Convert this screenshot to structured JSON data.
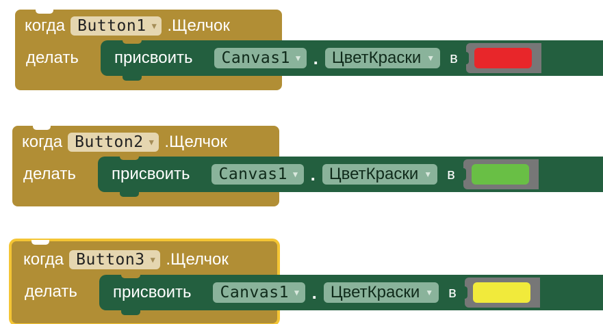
{
  "blocks": [
    {
      "when": "когда",
      "component": "Button1",
      "event": ".Щелчок",
      "do": "делать",
      "set_label": "присвоить",
      "target": "Canvas1",
      "dot": ".",
      "property": "ЦветКраски",
      "to": "в",
      "color": "#e8262a",
      "selected": false
    },
    {
      "when": "когда",
      "component": "Button2",
      "event": ".Щелчок",
      "do": "делать",
      "set_label": "присвоить",
      "target": "Canvas1",
      "dot": ".",
      "property": "ЦветКраски",
      "to": "в",
      "color": "#69bf45",
      "selected": false
    },
    {
      "when": "когда",
      "component": "Button3",
      "event": ".Щелчок",
      "do": "делать",
      "set_label": "присвоить",
      "target": "Canvas1",
      "dot": ".",
      "property": "ЦветКраски",
      "to": "в",
      "color": "#f1ea3b",
      "selected": true
    }
  ],
  "icons": {
    "dropdown": "chevron-down-icon"
  }
}
